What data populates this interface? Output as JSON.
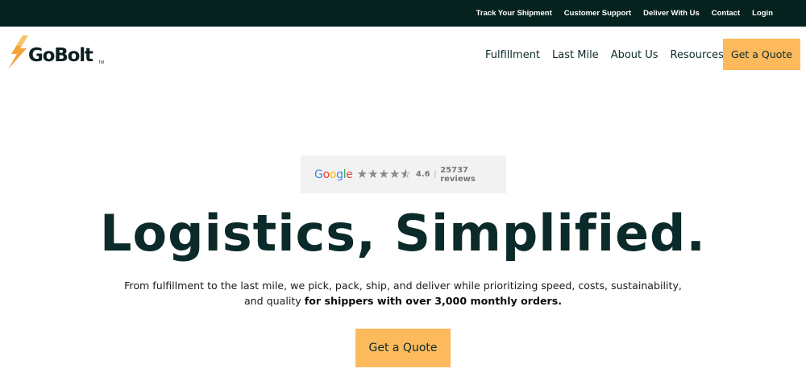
{
  "topbar": {
    "links": [
      {
        "label": "Track Your Shipment"
      },
      {
        "label": "Customer Support"
      },
      {
        "label": "Deliver With Us"
      },
      {
        "label": "Contact"
      },
      {
        "label": "Login"
      }
    ]
  },
  "header": {
    "logo_text": "GoBolt",
    "logo_tm": "TM",
    "nav": [
      {
        "label": "Fulfillment"
      },
      {
        "label": "Last Mile"
      },
      {
        "label": "About Us"
      },
      {
        "label": "Resources"
      }
    ],
    "cta_label": "Get a Quote"
  },
  "review_badge": {
    "brand_letters": [
      "G",
      "o",
      "o",
      "g",
      "l",
      "e"
    ],
    "brand_colors": [
      "#4285F4",
      "#EA4335",
      "#FBBC05",
      "#4285F4",
      "#34A853",
      "#EA4335"
    ],
    "stars": 4.6,
    "rating": "4.6",
    "separator": "|",
    "reviews": "25737 reviews"
  },
  "hero": {
    "title": "Logistics, Simplified.",
    "subtitle_plain": "From fulfillment to the last mile, we pick, pack, ship, and deliver while prioritizing speed, costs, sustainability, and quality",
    "subtitle_bold": "for shippers with over 3,000 monthly orders.",
    "cta_label": "Get a Quote"
  },
  "colors": {
    "topbar_bg": "#06221f",
    "accent": "#fdba5d",
    "text_dark": "#0b2a2a",
    "bolt_orange": "#f2a33a"
  }
}
